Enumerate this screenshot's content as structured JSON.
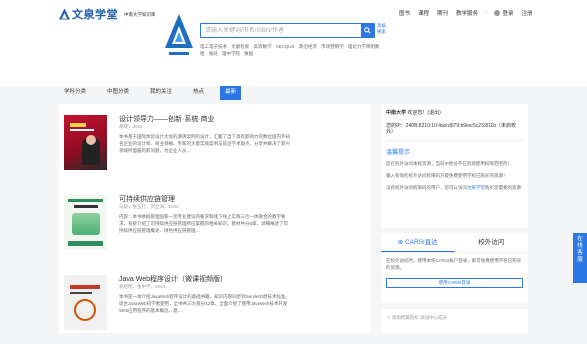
{
  "header": {
    "logo_text": "文泉学堂",
    "logo_sub": "中南大学知识库",
    "nav": [
      "图书",
      "课程",
      "期刊",
      "教学服务"
    ],
    "login": "登录",
    "register": "注册"
  },
  "search": {
    "placeholder": "请输入关键词/书名/ISBN/作者",
    "advanced": "高级\n搜索",
    "hot_words": [
      "电工电子技术",
      "文献检索",
      "高等数学",
      "ABAQUS",
      "政治经济",
      "市场营销学",
      "理论力学简明教程",
      "微处",
      "理中学院",
      "数据"
    ]
  },
  "tabs": [
    "学科分类",
    "中图分类",
    "我的关注",
    "热点",
    "最新"
  ],
  "active_tab": "最新",
  "books": [
    {
      "title": "设计领导力——创新·系统·商业",
      "meta": "胡晓，2024",
      "desc": "本书基于国际体验设计大会的演讲案例的设计，汇聚了当下具有影响力的数位国内外知名企业的设计师、商业领袖、专家的大量实践案例与前沿学术观点，分享并解决了新兴领域所面临的新问题，为企业人员…"
    },
    {
      "title": "可持续供应链管理",
      "meta": "马毅，张玉行，刘立涛，2024",
      "desc": "内容：本书依据管理国家一流专业建设的要求和线下线上实践三位一体融合的教学要求，系统介绍了可持续供应链管理所应掌握的相关知识。教材共分6章，详细阐述了可持续供应链管理概述、绿色供应链管理…"
    },
    {
      "title": "Java Web程序设计（微课视频版）",
      "meta": "袁绍明，张中宇，2024",
      "desc": "本书是一本介绍JavaWeb程序设计的基础书籍，知识内容同步到ServletD原技术标准。适合JavaWeb初学者使用，全书共三大部分12章，全面介绍了使用JavaWeb技术开发Web应用程序的基本概念、基…"
    }
  ],
  "sidebar": {
    "welcome_school": "中南大学",
    "welcome_suffix": "欢迎您！(退出)",
    "ip_line": "您的IP：240B:8210:10:4ad:d079:b9ea:5c23:811b（未启校外）",
    "login_hint": "温馨提示",
    "hint1": "您在校外访问本校资源，当前IP地址不在资源使用权限范围内！",
    "hint2": "输入有效的校外访问权限码方能免费使用学校已购买的资源！",
    "hint3_pre": "没有校外访问权限码的用户，您可以访问",
    "hint3_link": "文泉学堂",
    "hint3_post": "购买您需要的资源",
    "carsi_tab": "CARSI直达",
    "offcampus_tab": "校外访问",
    "carsi_text": "在校外访问时，使用本校CARSI账户登录，即可免费使用学校已购买的资源。",
    "carsi_btn": "使用CARSI登录",
    "add_domain": "添加所属院校 添加中心成员"
  },
  "float": [
    "在",
    "线",
    "客",
    "服"
  ]
}
